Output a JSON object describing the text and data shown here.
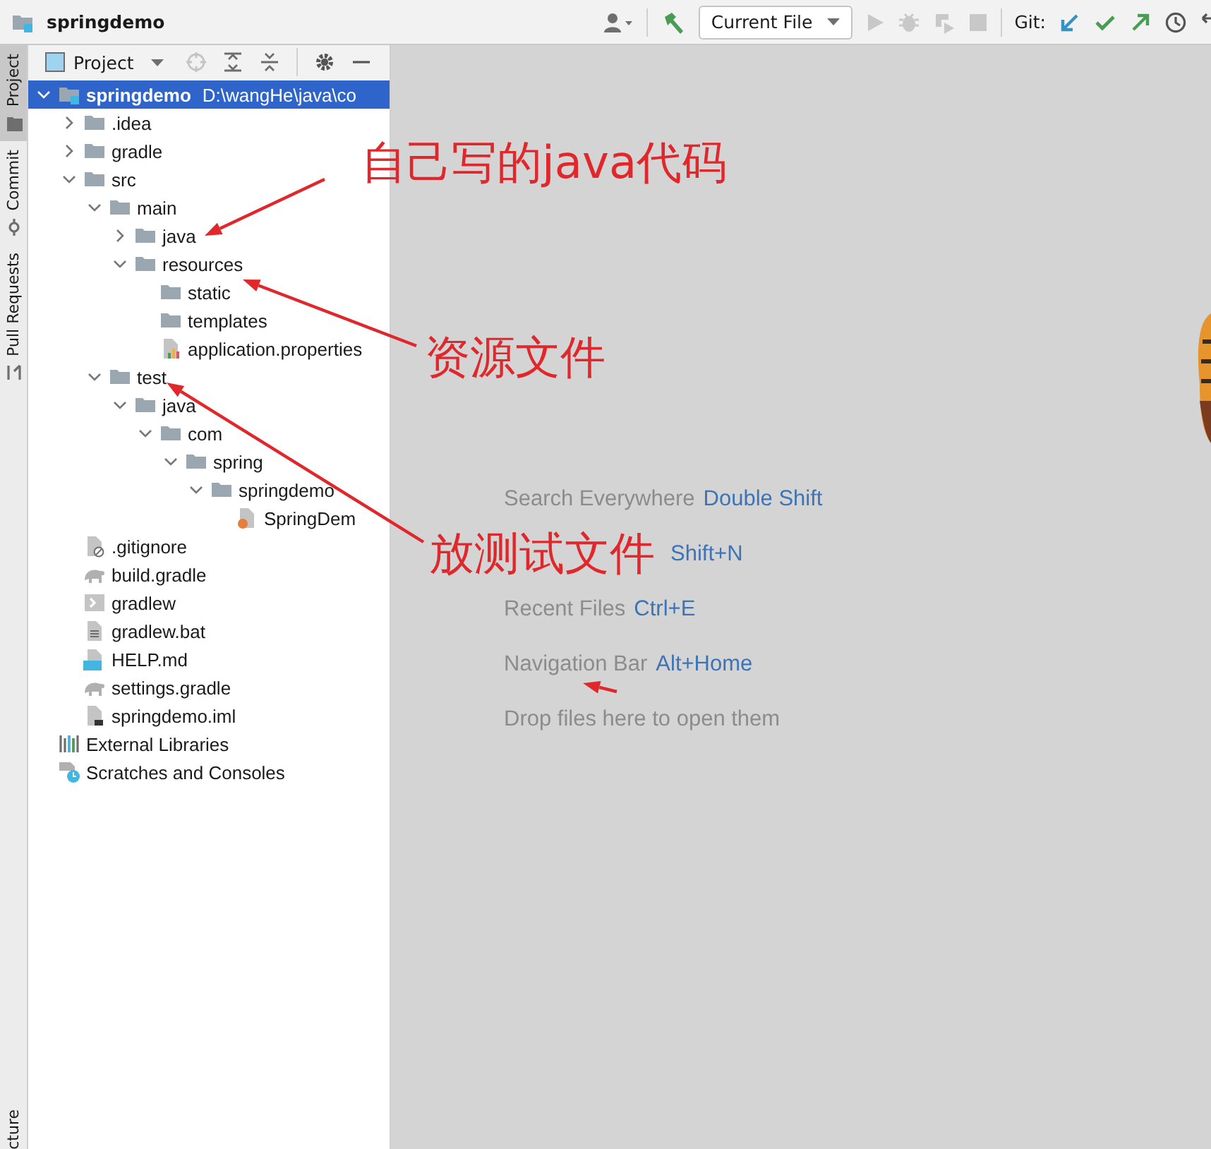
{
  "toolbar": {
    "project_name": "springdemo",
    "run_config": "Current File",
    "vcs_label": "Git:"
  },
  "tool_strip": {
    "tabs": [
      {
        "label": "Project",
        "selected": true
      },
      {
        "label": "Commit",
        "selected": false
      },
      {
        "label": "Pull Requests",
        "selected": false
      }
    ],
    "bottom_tabs": [
      {
        "label": "cture",
        "selected": false
      }
    ]
  },
  "project_panel": {
    "title": "Project",
    "tree": [
      {
        "name": "springdemo",
        "path": "D:\\wangHe\\java\\co",
        "kind": "module",
        "expanded": true,
        "selected": true,
        "children": [
          {
            "name": ".idea",
            "kind": "folder",
            "expanded": false,
            "selected": false
          },
          {
            "name": "gradle",
            "kind": "folder",
            "expanded": false,
            "selected": false
          },
          {
            "name": "src",
            "kind": "folder",
            "expanded": true,
            "selected": false,
            "children": [
              {
                "name": "main",
                "kind": "folder",
                "expanded": true,
                "selected": false,
                "children": [
                  {
                    "name": "java",
                    "kind": "folder",
                    "expanded": false,
                    "selected": false
                  },
                  {
                    "name": "resources",
                    "kind": "folder",
                    "expanded": true,
                    "selected": false,
                    "children": [
                      {
                        "name": "static",
                        "kind": "folder",
                        "selected": false
                      },
                      {
                        "name": "templates",
                        "kind": "folder",
                        "selected": false
                      },
                      {
                        "name": "application.properties",
                        "kind": "properties",
                        "selected": false
                      }
                    ]
                  }
                ]
              },
              {
                "name": "test",
                "kind": "folder",
                "expanded": true,
                "selected": false,
                "children": [
                  {
                    "name": "java",
                    "kind": "folder",
                    "expanded": true,
                    "selected": false,
                    "children": [
                      {
                        "name": "com",
                        "kind": "folder",
                        "expanded": true,
                        "selected": false,
                        "children": [
                          {
                            "name": "spring",
                            "kind": "folder",
                            "expanded": true,
                            "selected": false,
                            "children": [
                              {
                                "name": "springdemo",
                                "kind": "folder",
                                "expanded": true,
                                "selected": false,
                                "children": [
                                  {
                                    "name": "SpringDem",
                                    "kind": "java",
                                    "selected": false
                                  }
                                ]
                              }
                            ]
                          }
                        ]
                      }
                    ]
                  }
                ]
              }
            ]
          },
          {
            "name": ".gitignore",
            "kind": "ignore",
            "selected": false
          },
          {
            "name": "build.gradle",
            "kind": "gradle",
            "selected": false
          },
          {
            "name": "gradlew",
            "kind": "script",
            "selected": false
          },
          {
            "name": "gradlew.bat",
            "kind": "text",
            "selected": false
          },
          {
            "name": "HELP.md",
            "kind": "markdown",
            "selected": false
          },
          {
            "name": "settings.gradle",
            "kind": "gradle",
            "selected": false
          },
          {
            "name": "springdemo.iml",
            "kind": "iml",
            "selected": false
          }
        ]
      },
      {
        "name": "External Libraries",
        "kind": "libraries",
        "selected": false
      },
      {
        "name": "Scratches and Consoles",
        "kind": "scratches",
        "selected": false
      }
    ]
  },
  "editor_hints": [
    {
      "action": "Search Everywhere",
      "shortcut": "Double Shift"
    },
    {
      "shortcut": "Shift+N"
    },
    {
      "action": "Recent Files",
      "shortcut": "Ctrl+E"
    },
    {
      "action": "Navigation Bar",
      "shortcut": "Alt+Home"
    },
    {
      "action": "Drop files here to open them"
    }
  ],
  "annotations": [
    {
      "text": "自己写的java代码"
    },
    {
      "text": "资源文件"
    },
    {
      "text": "放测试文件"
    }
  ]
}
